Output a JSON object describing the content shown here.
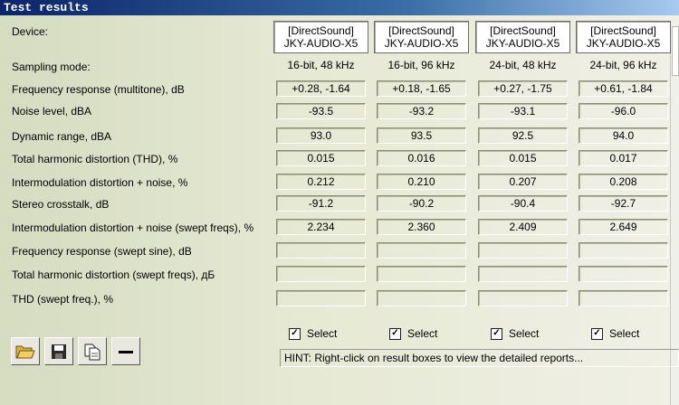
{
  "window": {
    "title": "Test results"
  },
  "labels": {
    "device": "Device:",
    "sampling_mode": "Sampling mode:",
    "rows": [
      "Frequency response (multitone), dB",
      "Noise level, dBA",
      "Dynamic range, dBA",
      "Total harmonic distortion (THD), %",
      "Intermodulation distortion + noise, %",
      "Stereo crosstalk, dB",
      "Intermodulation distortion + noise (swept freqs), %",
      "Frequency response (swept sine), dB",
      "Total harmonic distortion (swept freqs), дБ",
      "THD (swept freq.), %"
    ]
  },
  "columns": [
    {
      "device_line1": "[DirectSound]",
      "device_line2": "JKY-AUDIO-X5",
      "mode": "16-bit, 48 kHz",
      "values": [
        "+0.28, -1.64",
        "-93.5",
        "93.0",
        "0.015",
        "0.212",
        "-91.2",
        "2.234",
        "",
        "",
        ""
      ],
      "select_label": "Select",
      "selected": true
    },
    {
      "device_line1": "[DirectSound]",
      "device_line2": "JKY-AUDIO-X5",
      "mode": "16-bit, 96 kHz",
      "values": [
        "+0.18, -1.65",
        "-93.2",
        "93.5",
        "0.016",
        "0.210",
        "-90.2",
        "2.360",
        "",
        "",
        ""
      ],
      "select_label": "Select",
      "selected": true
    },
    {
      "device_line1": "[DirectSound]",
      "device_line2": "JKY-AUDIO-X5",
      "mode": "24-bit, 48 kHz",
      "values": [
        "+0.27, -1.75",
        "-93.1",
        "92.5",
        "0.015",
        "0.207",
        "-90.4",
        "2.409",
        "",
        "",
        ""
      ],
      "select_label": "Select",
      "selected": true
    },
    {
      "device_line1": "[DirectSound]",
      "device_line2": "JKY-AUDIO-X5",
      "mode": "24-bit, 96 kHz",
      "values": [
        "+0.61, -1.84",
        "-96.0",
        "94.0",
        "0.017",
        "0.208",
        "-92.7",
        "2.649",
        "",
        "",
        ""
      ],
      "select_label": "Select",
      "selected": true
    }
  ],
  "hint": "HINT: Right-click on result boxes to view the detailed reports...",
  "toolbar": [
    {
      "icon": "open-folder-icon"
    },
    {
      "icon": "save-disk-icon"
    },
    {
      "icon": "copy-pages-icon"
    },
    {
      "icon": "remove-minus-icon"
    }
  ]
}
